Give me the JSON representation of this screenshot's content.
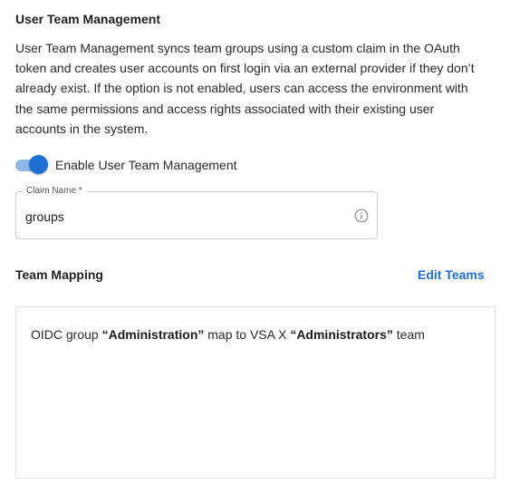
{
  "section": {
    "title": "User Team Management",
    "description": "User Team Management syncs team groups using a custom claim in the OAuth token and creates user accounts on first login via an external provider if they don’t already exist. If the option is not enabled, users can access the environment with the same permissions and access rights associated with their existing user accounts in the system."
  },
  "toggle": {
    "label": "Enable User Team Management",
    "enabled": true
  },
  "claim_field": {
    "label": "Claim Name *",
    "value": "groups",
    "icon": "info-icon"
  },
  "team_mapping": {
    "title": "Team Mapping",
    "edit_label": "Edit Teams",
    "entries": [
      {
        "prefix": "OIDC group ",
        "group": "“Administration”",
        "middle": " map to VSA X ",
        "team": "“Administrators”",
        "suffix": " team"
      }
    ]
  },
  "colors": {
    "accent": "#1e6fd6",
    "toggle_track": "#8fb8e6"
  }
}
